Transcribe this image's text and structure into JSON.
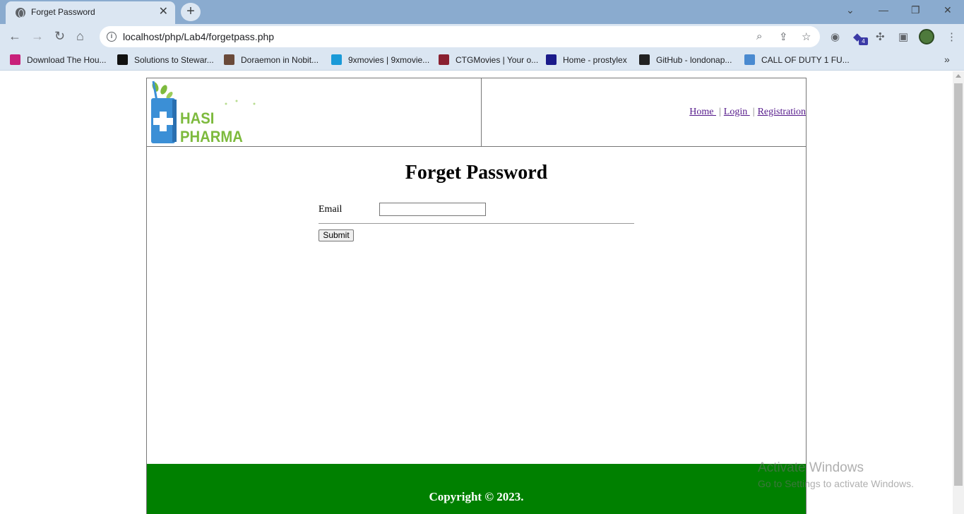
{
  "browser": {
    "tab_title": "Forget Password",
    "tab_close": "✕",
    "new_tab": "+",
    "url": "localhost/php/Lab4/forgetpass.php",
    "extension_badge": "4",
    "bookmarks": [
      {
        "label": "Download The Hou...",
        "color": "#c8207a"
      },
      {
        "label": "Solutions to Stewar...",
        "color": "#111111"
      },
      {
        "label": "Doraemon in Nobit...",
        "color": "#6a4a3a"
      },
      {
        "label": "9xmovies | 9xmovie...",
        "color": "#1a9ad8"
      },
      {
        "label": "CTGMovies | Your o...",
        "color": "#8a2030"
      },
      {
        "label": "Home - prostylex",
        "color": "#1a1a8a"
      },
      {
        "label": "GitHub - londonap...",
        "color": "#222222"
      },
      {
        "label": "CALL OF DUTY 1 FU...",
        "color": "#4a8ad0"
      }
    ]
  },
  "header": {
    "logo_text": "HASI PHARMA",
    "nav": {
      "home": "Home ",
      "login": "Login ",
      "registration": "Registration",
      "separator": "|"
    }
  },
  "main": {
    "title": "Forget Password",
    "email_label": "Email",
    "email_value": "",
    "submit_label": "Submit"
  },
  "footer": {
    "copyright": "Copyright © 2023."
  },
  "watermark": {
    "line1": "Activate Windows",
    "line2": "Go to Settings to activate Windows."
  },
  "colors": {
    "footer_bg": "#008000",
    "logo_green": "#7dba3d",
    "logo_blue": "#3b8fd6"
  }
}
